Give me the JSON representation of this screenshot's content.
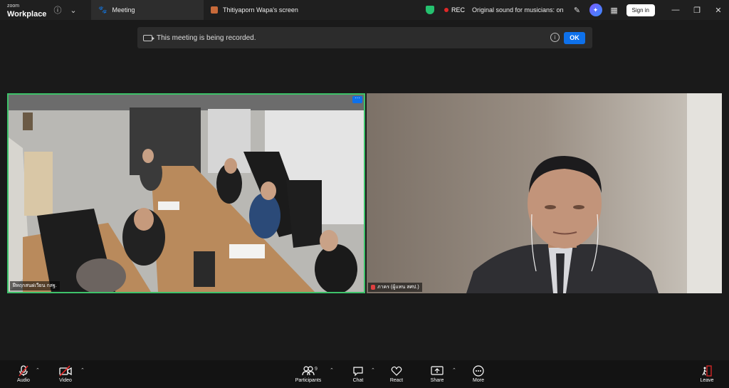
{
  "app": {
    "logo_top": "zoom",
    "logo_bottom": "Workplace"
  },
  "tabs": [
    {
      "label": "Meeting"
    },
    {
      "label": "Thitiyaporn Wapa's screen"
    }
  ],
  "status": {
    "rec": "REC",
    "original_sound": "Original sound for musicians: on",
    "sign_in": "Sign in"
  },
  "banner": {
    "text": "This meeting is being recorded.",
    "ok": "OK"
  },
  "tiles": [
    {
      "name": "ฝีหฤกสนฝเวียน กสฐ."
    },
    {
      "name": "ภาคร (ผู้แทน สศป.)"
    }
  ],
  "toolbar": {
    "audio": "Audio",
    "video": "Video",
    "participants": "Participants",
    "participants_count": "9",
    "chat": "Chat",
    "react": "React",
    "share": "Share",
    "more": "More",
    "leave": "Leave"
  },
  "colors": {
    "accent": "#0e71eb",
    "active_speaker": "#3ec26a",
    "rec": "#e02828",
    "leave": "#e02828"
  }
}
